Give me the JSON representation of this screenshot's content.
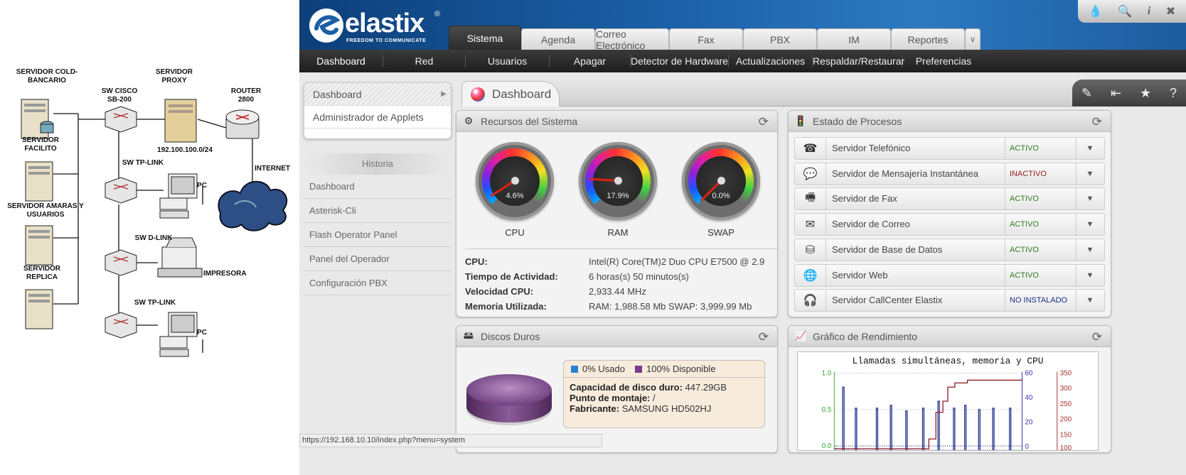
{
  "diagram": {
    "labels": {
      "server_cold": "SERVIDOR COLD-\nBANCARIO",
      "server_proxy": "SERVIDOR\nPROXY",
      "sw_cisco": "SW CISCO\nSB-200",
      "router": "ROUTER\n2800",
      "server_facilito": "SERVIDOR\nFACILITO",
      "ip": "192.100.100.0/24",
      "sw_tplink1": "SW TP-LINK",
      "internet": "INTERNET",
      "pc1": "PC",
      "server_amaras": "SERVIDOR AMARAS Y\nUSUARIOS",
      "sw_dlink": "SW  D-LINK",
      "server_replica": "SERVIDOR\nREPLICA",
      "impresora": "IMPRESORA",
      "sw_tplink2": "SW TP-LINK",
      "pc2": "PC"
    }
  },
  "elastix": {
    "logo": {
      "word": "elastix",
      "tagline": "FREEDOM TO COMMUNICATE",
      "reg": "®"
    },
    "tabs": [
      "Sistema",
      "Agenda",
      "Correo Electrónico",
      "Fax",
      "PBX",
      "IM",
      "Reportes"
    ],
    "tabs_more": "∨",
    "subnav": [
      "Dashboard",
      "Red",
      "Usuarios",
      "Apagar",
      "Detector de Hardware",
      "Actualizaciones",
      "Respaldar/Restaurar",
      "Preferencias"
    ],
    "applets": [
      "Dashboard",
      "Administrador de Applets"
    ],
    "historia_title": "Historia",
    "historia": [
      "Dashboard",
      "Asterisk-Cli",
      "Flash Operator Panel",
      "Panel del Operador",
      "Configuración PBX"
    ],
    "dashboard_title": "Dashboard",
    "recursos": {
      "title": "Recursos del Sistema",
      "gauges": [
        {
          "label": "CPU",
          "value": "4.6%",
          "fraction": 0.046
        },
        {
          "label": "RAM",
          "value": "17.9%",
          "fraction": 0.179
        },
        {
          "label": "SWAP",
          "value": "0.0%",
          "fraction": 0.0
        }
      ],
      "info": [
        {
          "k": "CPU:",
          "v": "Intel(R) Core(TM)2 Duo CPU E7500 @ 2.9"
        },
        {
          "k": "Tiempo de Actividad:",
          "v": "6 horas(s) 50 minutos(s)"
        },
        {
          "k": "Velocidad CPU:",
          "v": "2,933.44 MHz"
        },
        {
          "k": "Memoria Utilizada:",
          "v": "RAM: 1,988.58 Mb SWAP: 3,999.99 Mb"
        }
      ]
    },
    "procesos": {
      "title": "Estado de Procesos",
      "items": [
        {
          "name": "Servidor Telefónico",
          "status": "ACTIVO",
          "color": "#2e7d1e",
          "icon": "phone-icon",
          "glyph": "☎"
        },
        {
          "name": "Servidor de Mensajería Instantánea",
          "status": "INACTIVO",
          "color": "#9a1a1a",
          "icon": "chat-icon",
          "glyph": "💬"
        },
        {
          "name": "Servidor de Fax",
          "status": "ACTIVO",
          "color": "#2e7d1e",
          "icon": "fax-icon",
          "glyph": "🖷"
        },
        {
          "name": "Servidor de Correo",
          "status": "ACTIVO",
          "color": "#2e7d1e",
          "icon": "mail-icon",
          "glyph": "✉"
        },
        {
          "name": "Servidor de Base de Datos",
          "status": "ACTIVO",
          "color": "#2e7d1e",
          "icon": "database-icon",
          "glyph": "⛁"
        },
        {
          "name": "Servidor Web",
          "status": "ACTIVO",
          "color": "#2e7d1e",
          "icon": "globe-icon",
          "glyph": "🌐"
        },
        {
          "name": "Servidor CallCenter Elastix",
          "status": "NO INSTALADO",
          "color": "#1a2f8a",
          "icon": "headset-icon",
          "glyph": "🎧"
        }
      ]
    },
    "discos": {
      "title": "Discos Duros",
      "used_label": "0% Usado",
      "free_label": "100% Disponible",
      "used_color": "#2b7fd4",
      "free_color": "#7a3d8a",
      "capacidad_k": "Capacidad de disco duro:",
      "capacidad_v": "447.29GB",
      "montaje_k": "Punto de montaje:",
      "montaje_v": "/",
      "fabricante_k": "Fabricante:",
      "fabricante_v": "SAMSUNG HD502HJ"
    },
    "grafico": {
      "title": "Gráfico de Rendimiento",
      "chart_title": "Llamadas simultáneas, memoria y CPU",
      "left_ticks": [
        "1.0",
        "0.5",
        "0.0"
      ],
      "mid_ticks": [
        "60",
        "40",
        "20",
        "0"
      ],
      "right_ticks": [
        "350",
        "300",
        "250",
        "200",
        "150",
        "100"
      ]
    },
    "status_url": "https://192.168.10.10/index.php?menu=system"
  }
}
